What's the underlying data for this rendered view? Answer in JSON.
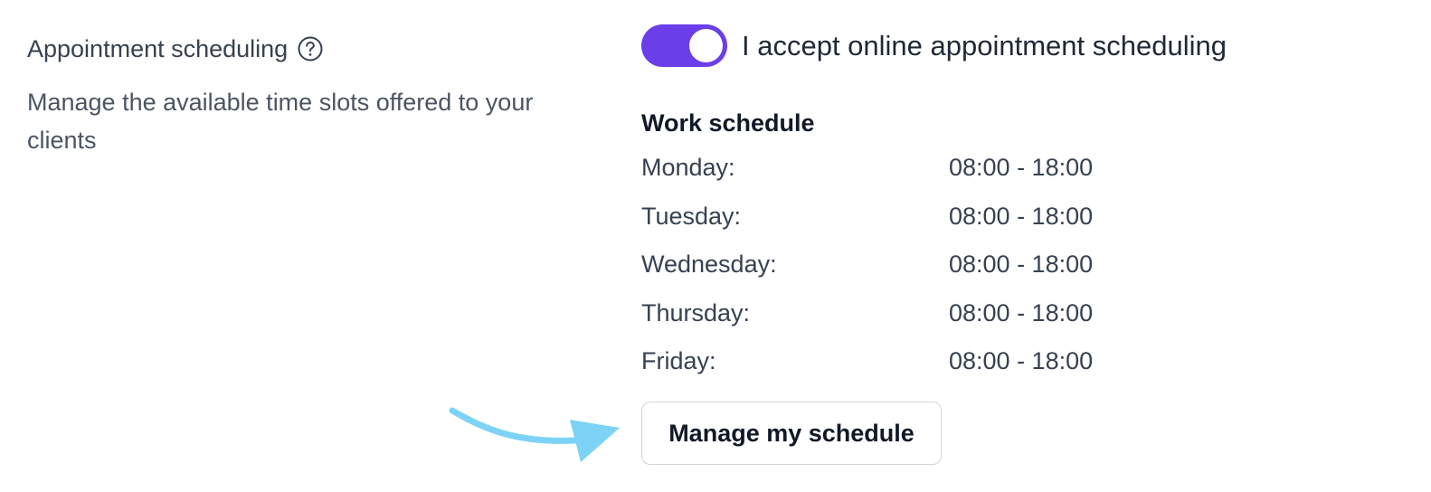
{
  "section": {
    "title": "Appointment scheduling",
    "help_icon": "question-circle-icon",
    "description": "Manage the available time slots offered to your clients"
  },
  "toggle": {
    "enabled": true,
    "label": "I accept online appointment scheduling",
    "color": "#6a3ee8"
  },
  "schedule": {
    "heading": "Work schedule",
    "days": [
      {
        "day": "Monday:",
        "hours": "08:00 - 18:00"
      },
      {
        "day": "Tuesday:",
        "hours": "08:00 - 18:00"
      },
      {
        "day": "Wednesday:",
        "hours": "08:00 - 18:00"
      },
      {
        "day": "Thursday:",
        "hours": "08:00 - 18:00"
      },
      {
        "day": "Friday:",
        "hours": "08:00 - 18:00"
      }
    ]
  },
  "manage_button": {
    "label": "Manage my schedule"
  },
  "annotation": {
    "icon": "curved-arrow-icon",
    "color": "#7dd3f5"
  }
}
